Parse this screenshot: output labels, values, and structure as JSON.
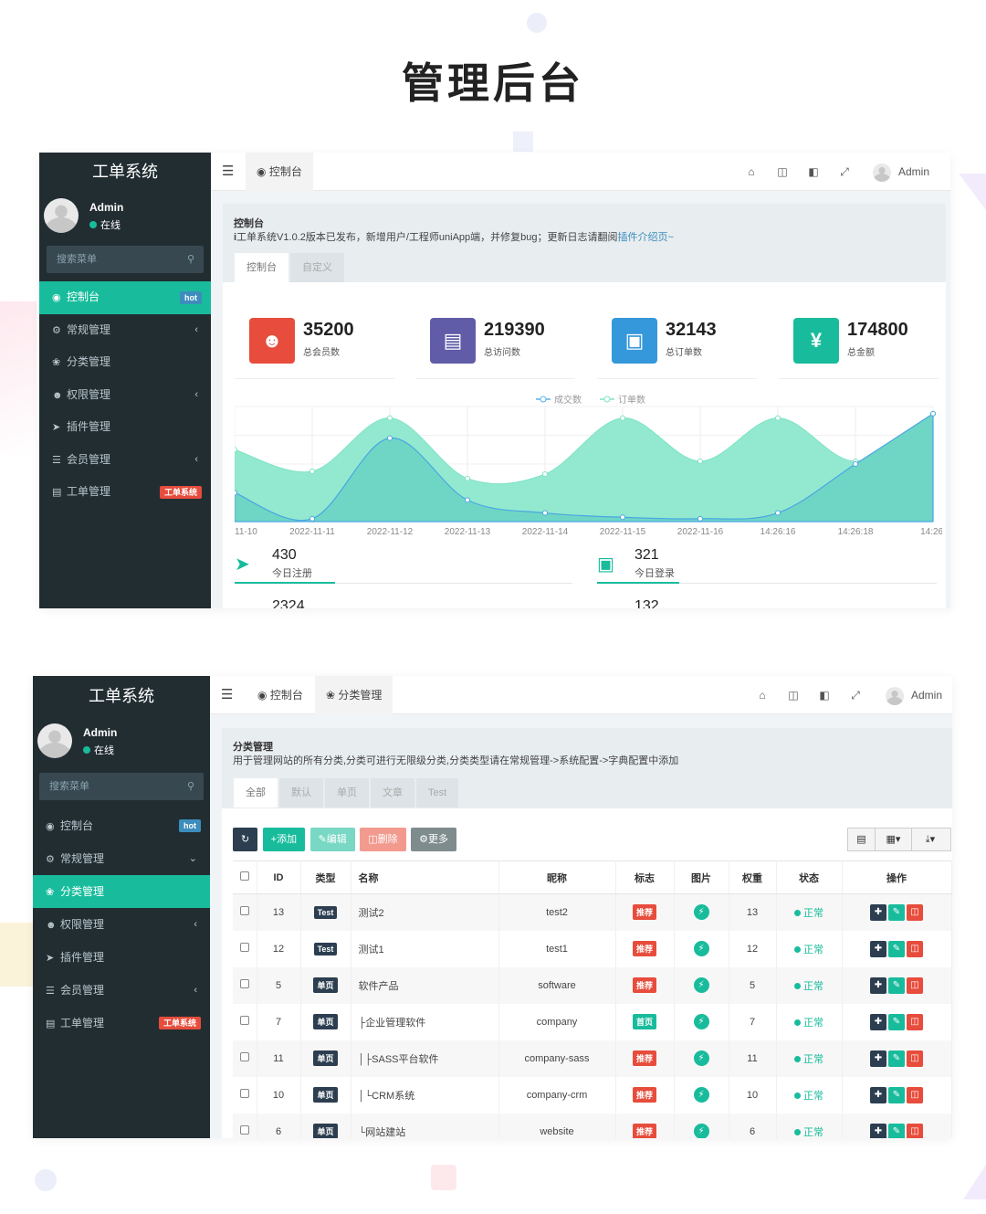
{
  "page_title": "管理后台",
  "screen1": {
    "sidebar": {
      "brand": "工单系统",
      "user_name": "Admin",
      "user_status": "在线",
      "search_placeholder": "搜索菜单",
      "menu": [
        {
          "label": "控制台",
          "icon": "dashboard-icon",
          "badge": "hot",
          "active": true
        },
        {
          "label": "常规管理",
          "icon": "cogs-icon",
          "arrow": "‹"
        },
        {
          "label": "分类管理",
          "icon": "leaf-icon"
        },
        {
          "label": "权限管理",
          "icon": "group-icon",
          "arrow": "‹"
        },
        {
          "label": "插件管理",
          "icon": "rocket-icon"
        },
        {
          "label": "会员管理",
          "icon": "list-icon",
          "arrow": "‹"
        },
        {
          "label": "工单管理",
          "icon": "list-alt-icon",
          "badge": "工单系统"
        }
      ]
    },
    "topbar": {
      "tab": "控制台",
      "admin": "Admin"
    },
    "notice": {
      "title": "控制台",
      "desc": "工单系统V1.0.2版本已发布，新增用户/工程师uniApp端，并修复bug；更新日志请翻阅",
      "link": "插件介绍页~"
    },
    "subtabs": [
      "控制台",
      "自定义"
    ],
    "stats": [
      {
        "value": "35200",
        "label": "总会员数",
        "color": "#e74c3c",
        "icon": "users-icon"
      },
      {
        "value": "219390",
        "label": "总访问数",
        "color": "#605ca8",
        "icon": "book-icon"
      },
      {
        "value": "32143",
        "label": "总订单数",
        "color": "#3498db",
        "icon": "shopping-bag-icon"
      },
      {
        "value": "174800",
        "label": "总金额",
        "color": "#18bc9c",
        "icon": "yen-icon"
      }
    ],
    "chart_data": {
      "type": "area",
      "x": [
        "11-10",
        "2022-11-11",
        "2022-11-12",
        "2022-11-13",
        "2022-11-14",
        "2022-11-15",
        "2022-11-16",
        "14:26:16",
        "14:26:18",
        "14:26:"
      ],
      "series": [
        {
          "name": "成交数",
          "values": [
            20,
            2,
            58,
            15,
            6,
            3,
            2,
            6,
            40,
            75
          ]
        },
        {
          "name": "订单数",
          "values": [
            50,
            35,
            72,
            30,
            33,
            72,
            42,
            72,
            42,
            75
          ]
        }
      ],
      "colors": [
        "#5cb0e6",
        "#7ee3c4"
      ]
    },
    "bottom_stats": [
      {
        "value": "430",
        "label": "今日注册",
        "icon": "rocket-icon"
      },
      {
        "value": "321",
        "label": "今日登录",
        "icon": "cart-icon"
      },
      {
        "value": "2324",
        "label": "",
        "icon": "trend-icon"
      },
      {
        "value": "132",
        "label": "",
        "icon": "users-icon"
      }
    ]
  },
  "screen2": {
    "sidebar": {
      "brand": "工单系统",
      "user_name": "Admin",
      "user_status": "在线",
      "search_placeholder": "搜索菜单",
      "menu": [
        {
          "label": "控制台",
          "icon": "dashboard-icon",
          "badge": "hot"
        },
        {
          "label": "常规管理",
          "icon": "cogs-icon",
          "arrow": "⌄"
        },
        {
          "label": "分类管理",
          "icon": "leaf-icon",
          "active": true
        },
        {
          "label": "权限管理",
          "icon": "group-icon",
          "arrow": "‹"
        },
        {
          "label": "插件管理",
          "icon": "rocket-icon"
        },
        {
          "label": "会员管理",
          "icon": "list-icon",
          "arrow": "‹"
        },
        {
          "label": "工单管理",
          "icon": "list-alt-icon",
          "badge": "工单系统"
        }
      ]
    },
    "topbar": {
      "tabs": [
        "控制台",
        "分类管理"
      ],
      "admin": "Admin"
    },
    "notice": {
      "title": "分类管理",
      "desc": "用于管理网站的所有分类,分类可进行无限级分类,分类类型请在常规管理->系统配置->字典配置中添加"
    },
    "subtabs": [
      "全部",
      "默认",
      "单页",
      "文章",
      "Test"
    ],
    "toolbar": {
      "add": "添加",
      "edit": "编辑",
      "delete": "删除",
      "more": "更多"
    },
    "table": {
      "headers": [
        "ID",
        "类型",
        "名称",
        "昵称",
        "标志",
        "图片",
        "权重",
        "状态",
        "操作"
      ],
      "rows": [
        {
          "id": "13",
          "type": "Test",
          "name": "测试2",
          "nick": "test2",
          "flag": "推荐",
          "flag_color": "red",
          "weigh": "13",
          "status": "正常"
        },
        {
          "id": "12",
          "type": "Test",
          "name": "测试1",
          "nick": "test1",
          "flag": "推荐",
          "flag_color": "red",
          "weigh": "12",
          "status": "正常"
        },
        {
          "id": "5",
          "type": "单页",
          "name": "软件产品",
          "nick": "software",
          "flag": "推荐",
          "flag_color": "red",
          "weigh": "5",
          "status": "正常"
        },
        {
          "id": "7",
          "type": "单页",
          "name": "├企业管理软件",
          "nick": "company",
          "flag": "首页",
          "flag_color": "green",
          "weigh": "7",
          "status": "正常"
        },
        {
          "id": "11",
          "type": "单页",
          "name": "│├SASS平台软件",
          "nick": "company-sass",
          "flag": "推荐",
          "flag_color": "red",
          "weigh": "11",
          "status": "正常"
        },
        {
          "id": "10",
          "type": "单页",
          "name": "│└CRM系统",
          "nick": "company-crm",
          "flag": "推荐",
          "flag_color": "red",
          "weigh": "10",
          "status": "正常"
        },
        {
          "id": "6",
          "type": "单页",
          "name": "└网站建站",
          "nick": "website",
          "flag": "推荐",
          "flag_color": "red",
          "weigh": "6",
          "status": "正常"
        }
      ]
    }
  }
}
